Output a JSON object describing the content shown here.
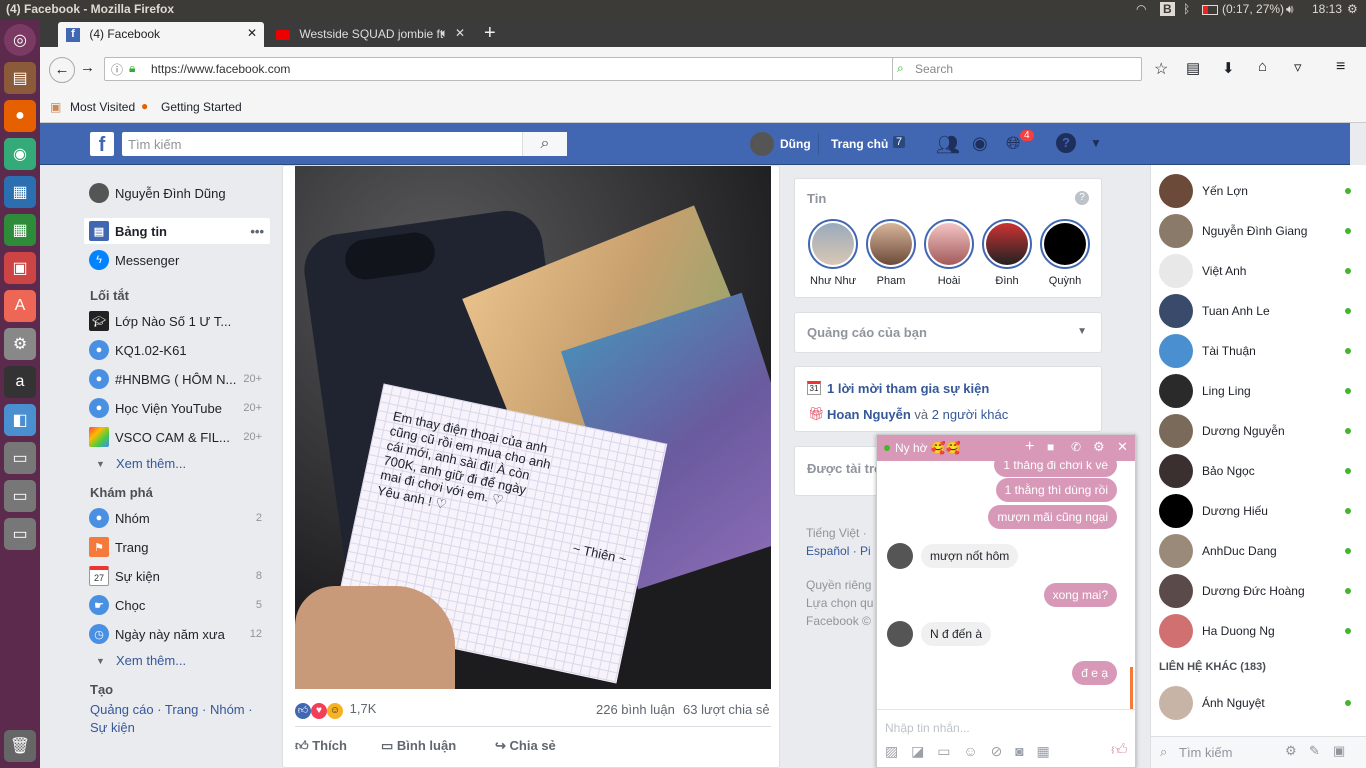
{
  "os": {
    "window_title": "(4) Facebook - Mozilla Firefox",
    "battery": "(0:17, 27%)",
    "clock": "18:13"
  },
  "browser": {
    "tabs": [
      {
        "label": "(4) Facebook"
      },
      {
        "label": "Westside SQUAD jombie ft"
      }
    ],
    "url": "https://www.facebook.com",
    "search_placeholder": "Search",
    "bookmarks": [
      "Most Visited",
      "Getting Started"
    ]
  },
  "fb_header": {
    "search_placeholder": "Tìm kiếm",
    "user": "Dũng",
    "home": "Trang chủ",
    "home_count": "7",
    "notif_count": "4"
  },
  "leftnav": {
    "profile": "Nguyễn Đình Dũng",
    "newsfeed": "Bảng tin",
    "messenger": "Messenger",
    "shortcuts_title": "Lối tắt",
    "shortcuts": [
      {
        "label": "Lớp Nào Số 1 Ư T...",
        "count": ""
      },
      {
        "label": "KQ1.02-K61",
        "count": ""
      },
      {
        "label": "#HNBMG ( HÔM N...",
        "count": "20+"
      },
      {
        "label": "Học Viện YouTube",
        "count": "20+"
      },
      {
        "label": "VSCO CAM & FIL...",
        "count": "20+"
      }
    ],
    "see_more": "Xem thêm...",
    "explore_title": "Khám phá",
    "explore": [
      {
        "label": "Nhóm",
        "count": "2"
      },
      {
        "label": "Trang",
        "count": ""
      },
      {
        "label": "Sự kiện",
        "count": "8"
      },
      {
        "label": "Chọc",
        "count": "5"
      },
      {
        "label": "Ngày này năm xưa",
        "count": "12"
      }
    ],
    "see_more2": "Xem thêm...",
    "create_title": "Tạo",
    "create_links": "Quảng cáo · Trang · Nhóm ·",
    "create_links2": "Sự kiện",
    "calendar_day": "27"
  },
  "post": {
    "reaction_count": "1,7K",
    "comments": "226 bình luận",
    "shares": "63 lượt chia sẻ",
    "actions": [
      "Thích",
      "Bình luận",
      "Chia sẻ"
    ],
    "note_lines": [
      "Em thay điện thoại của anh",
      "cũng cũ rồi em mua cho anh",
      "cái mới, anh sài đi! À còn",
      "700K, anh giữ đi để ngày",
      "mai đi chơi với em. ♡",
      "Yêu anh ! ♡",
      "~ Thiên ~"
    ]
  },
  "stories": {
    "title": "Tin",
    "items": [
      "Như Như",
      "Pham",
      "Hoài",
      "Đình",
      "Quỳnh"
    ]
  },
  "ads_title": "Quảng cáo của bạn",
  "events": {
    "calendar_day": "31",
    "invite": "1 lời mời tham gia sự kiện",
    "birthday_name": "Hoan Nguyễn",
    "birthday_rest": " và ",
    "birthday_others": "2 người khác"
  },
  "sponsored_partial": "Được tài trợ",
  "footer": {
    "langs": "Tiếng Việt ·",
    "langs2": "Español · Pi",
    "links": [
      "Quyền riêng",
      "Lựa chọn qu",
      "Facebook ©"
    ]
  },
  "chat": {
    "name": "Ny hờ 🥰🥰",
    "messages": [
      {
        "from": "me",
        "text": "1 thằng đi chơi k về"
      },
      {
        "from": "me",
        "text": "1 thằng thì dùng rồi"
      },
      {
        "from": "me",
        "text": "mượn mãi cũng ngại"
      },
      {
        "from": "them",
        "text": "mượn nốt hôm"
      },
      {
        "from": "me",
        "text": "xong mai?"
      },
      {
        "from": "them",
        "text": "N đ đến à"
      },
      {
        "from": "me",
        "text": "đ e ạ"
      }
    ],
    "input_placeholder": "Nhập tin nhắn..."
  },
  "contacts": {
    "online": [
      "Yến Lợn",
      "Nguyễn Đình Giang",
      "Việt Anh",
      "Tuan Anh Le",
      "Tài Thuận",
      "Ling Ling",
      "Dương Nguyễn",
      "Bảo Ngọc",
      "Dương Hiếu",
      "AnhDuc Dang",
      "Dương Đức Hoàng",
      "Ha Duong Ng"
    ],
    "other_title": "LIÊN HỆ KHÁC (183)",
    "other": [
      "Ánh Nguyệt"
    ],
    "search_placeholder": "Tìm kiếm"
  },
  "colors": {
    "fb_blue": "#4267b2",
    "chat_pink": "#d799b7",
    "online_green": "#42b72a"
  }
}
